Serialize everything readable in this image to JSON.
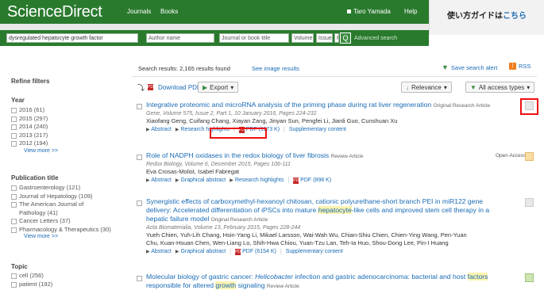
{
  "header": {
    "logo": "ScienceDirect",
    "nav": [
      "Journals",
      "Books"
    ],
    "user": "Taro Yamada",
    "help": "Help",
    "guide_prefix": "使い方ガイドは",
    "guide_link": "こちら"
  },
  "search": {
    "query": "dysregulated hepatocyte growth factor",
    "author_placeholder": "Author name",
    "journal_placeholder": "Journal or book title",
    "volume_placeholder": "Volume",
    "issue_placeholder": "Issue",
    "page_placeholder": "Page",
    "go_label": "Q",
    "advanced": "Advanced search"
  },
  "results_bar": {
    "count_text": "Search results: 2,165 results found",
    "see_images": "See image results",
    "save_alert": "Save search alert",
    "rss": "RSS"
  },
  "toolbar": {
    "download": "Download PDFs",
    "export": "Export",
    "relevance": "Relevance",
    "access": "All access types"
  },
  "sidebar": {
    "title": "Refine filters",
    "year_heading": "Year",
    "years": [
      "2016 (61)",
      "2015 (297)",
      "2014 (240)",
      "2013 (217)",
      "2012 (194)"
    ],
    "view_more_1": "View more >>",
    "pub_heading": "Publication title",
    "publications": [
      "Gastroenterology (121)",
      "Journal of Hepatology (109)",
      "The American Journal of",
      "Pathology (41)",
      "Cancer Letters (37)",
      "Pharmacology & Therapeutics (30)"
    ],
    "view_more_2": "View more >>",
    "topic_heading": "Topic",
    "topics": [
      "cell (256)",
      "patient (192)"
    ]
  },
  "results": [
    {
      "title": "Integrative proteomic and microRNA analysis of the priming phase during rat liver regeneration",
      "type": "Original Research Article",
      "source": "Gene, Volume 575, Issue 2, Part 1, 10 January 2016, Pages 224-232",
      "authors": "Xiaofang Geng, Cuifang Chang, Xiayan Zang, Jinyan Sun, Pengfei Li, Jianli Guo, Cunshuan Xu",
      "links": [
        "Abstract",
        "Research highlights"
      ],
      "pdf": "PDF (1173 K)",
      "supp": "Supplementary content"
    },
    {
      "title": "Role of NADPH oxidases in the redox biology of liver fibrosis",
      "type": "Review Article",
      "source": "Redox Biology, Volume 6, December 2015, Pages 106-111",
      "authors": "Eva Crosas-Molist, Isabel Fabregat",
      "links": [
        "Abstract",
        "Graphical abstract",
        "Research highlights"
      ],
      "pdf": "PDF (898 K)",
      "open_access": "Open Access"
    },
    {
      "title_a": "Synergistic effects of carboxymethyl-hexanoyl chitosan, cationic polyurethane-short branch PEI in miR122 gene",
      "title_b": "delivery: Accelerated differentiation of iPSCs into mature ",
      "title_hl": "hepatocyte",
      "title_c": "-like cells and improved stem cell therapy in a",
      "title_d": "hepatic failure model",
      "type": "Original Research Article",
      "source": "Acta Biomaterialia, Volume 13, February 2015, Pages 228-244",
      "authors_1": "Yueh Chien, Yuh-Lih Chang, Hsin-Yang Li, Mikael Larsson, Wai-Wah Wu, Chian-Shiu Chien, Chien-Ying Wang, Pen-Yuan",
      "authors_2": "Chu, Kuan-Hsuan Chen, Wen-Liang Lo, Shih-Hwa Chiou, Yuan-Tzu Lan, Teh-Ia Huo, Shou-Dong Lee, Pin-I Huang",
      "links": [
        "Abstract",
        "Graphical abstract"
      ],
      "pdf": "PDF (6154 K)",
      "supp": "Supplementary content"
    },
    {
      "title_a": "Molecular biology of gastric cancer: ",
      "title_italic": "Helicobacter",
      "title_b": " infection and gastric adenocarcinoma: bacterial and host ",
      "title_hl1": "factors",
      "title_c": "responsible for altered ",
      "title_hl2": "growth",
      "title_d": " signaling",
      "type": "Review Article"
    }
  ],
  "colors": {
    "brand_green": "#2a7a2e",
    "link_blue": "#1a6bb5",
    "highlight_red": "#e11111"
  }
}
